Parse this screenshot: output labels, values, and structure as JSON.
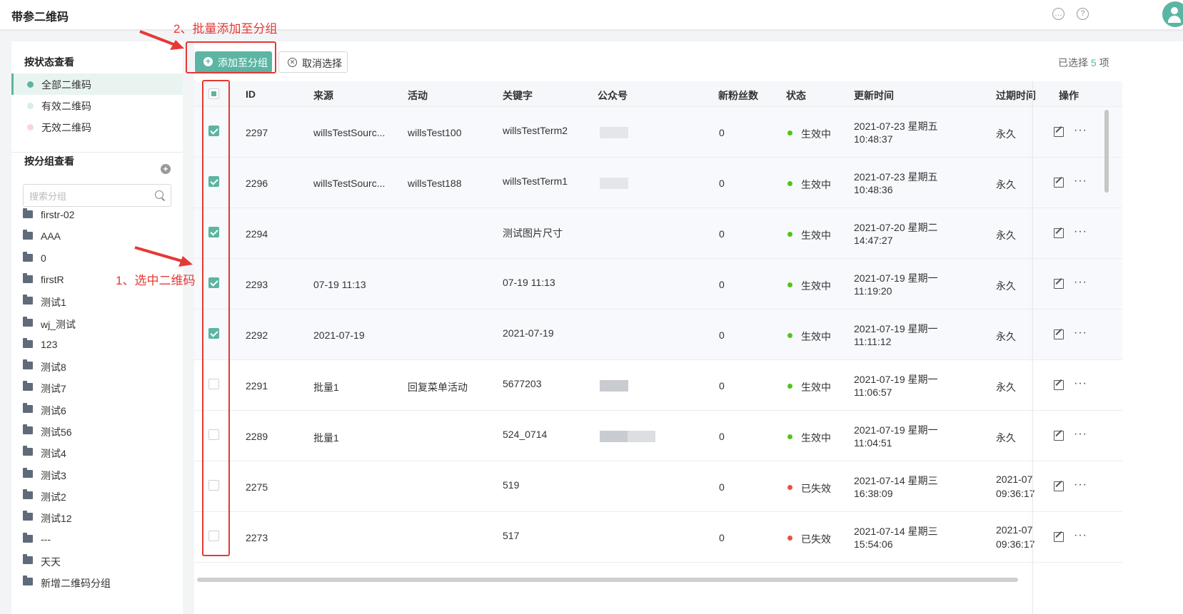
{
  "header": {
    "title": "带参二维码"
  },
  "sidebar": {
    "status_title": "按状态查看",
    "status_items": [
      {
        "label": "全部二维码",
        "color": "#5bb5a2"
      },
      {
        "label": "有效二维码",
        "color": "#d6efe8"
      },
      {
        "label": "无效二维码",
        "color": "#f7d8d3"
      }
    ],
    "group_title": "按分组查看",
    "search_placeholder": "搜索分组",
    "groups": [
      "firstr-02",
      "AAA",
      "0",
      "firstR",
      "测试1",
      "wj_测试",
      "123",
      "测试8",
      "测试7",
      "测试6",
      "测试56",
      "测试4",
      "测试3",
      "测试2",
      "测试12",
      "---",
      "天天",
      "新增二维码分组"
    ]
  },
  "toolbar": {
    "add_label": "添加至分组",
    "cancel_label": "取消选择",
    "selected_prefix": "已选择",
    "selected_count": "5",
    "selected_suffix": "项"
  },
  "table": {
    "columns": [
      "ID",
      "来源",
      "活动",
      "关键字",
      "公众号",
      "新粉丝数",
      "状态",
      "更新时间",
      "过期时间",
      "操作"
    ],
    "rows": [
      {
        "checked": true,
        "id": "2297",
        "source": "willsTestSourc...",
        "activity": "willsTest100",
        "keyword": "willsTestTerm2",
        "fans": "0",
        "status": "生效中",
        "status_color": "#52c41a",
        "updated_date": "2021-07-23 星期五",
        "updated_time": "10:48:37",
        "expire": "永久",
        "expire2": ""
      },
      {
        "checked": true,
        "id": "2296",
        "source": "willsTestSourc...",
        "activity": "willsTest188",
        "keyword": "willsTestTerm1",
        "fans": "0",
        "status": "生效中",
        "status_color": "#52c41a",
        "updated_date": "2021-07-23 星期五",
        "updated_time": "10:48:36",
        "expire": "永久",
        "expire2": ""
      },
      {
        "checked": true,
        "id": "2294",
        "source": "",
        "activity": "",
        "keyword": "测试图片尺寸",
        "fans": "0",
        "status": "生效中",
        "status_color": "#52c41a",
        "updated_date": "2021-07-20 星期二",
        "updated_time": "14:47:27",
        "expire": "永久",
        "expire2": ""
      },
      {
        "checked": true,
        "id": "2293",
        "source": "07-19 11:13",
        "activity": "",
        "keyword": "07-19 11:13",
        "fans": "0",
        "status": "生效中",
        "status_color": "#52c41a",
        "updated_date": "2021-07-19 星期一",
        "updated_time": "11:19:20",
        "expire": "永久",
        "expire2": ""
      },
      {
        "checked": true,
        "id": "2292",
        "source": "2021-07-19",
        "activity": "",
        "keyword": "2021-07-19",
        "fans": "0",
        "status": "生效中",
        "status_color": "#52c41a",
        "updated_date": "2021-07-19 星期一",
        "updated_time": "11:11:12",
        "expire": "永久",
        "expire2": ""
      },
      {
        "checked": false,
        "id": "2291",
        "source": "批量1",
        "activity": "回复菜单活动",
        "keyword": "5677203",
        "fans": "0",
        "status": "生效中",
        "status_color": "#52c41a",
        "updated_date": "2021-07-19 星期一",
        "updated_time": "11:06:57",
        "expire": "永久",
        "expire2": ""
      },
      {
        "checked": false,
        "id": "2289",
        "source": "批量1",
        "activity": "",
        "keyword": "524_0714",
        "fans": "0",
        "status": "生效中",
        "status_color": "#52c41a",
        "updated_date": "2021-07-19 星期一",
        "updated_time": "11:04:51",
        "expire": "永久",
        "expire2": ""
      },
      {
        "checked": false,
        "id": "2275",
        "source": "",
        "activity": "",
        "keyword": "519",
        "fans": "0",
        "status": "已失效",
        "status_color": "#e5533d",
        "updated_date": "2021-07-14 星期三",
        "updated_time": "16:38:09",
        "expire": "2021-07",
        "expire2": "09:36:17"
      },
      {
        "checked": false,
        "id": "2273",
        "source": "",
        "activity": "",
        "keyword": "517",
        "fans": "0",
        "status": "已失效",
        "status_color": "#e5533d",
        "updated_date": "2021-07-14 星期三",
        "updated_time": "15:54:06",
        "expire": "2021-07",
        "expire2": "09:36:17"
      }
    ]
  },
  "annotations": {
    "step1": "1、选中二维码",
    "step2": "2、批量添加至分组"
  }
}
